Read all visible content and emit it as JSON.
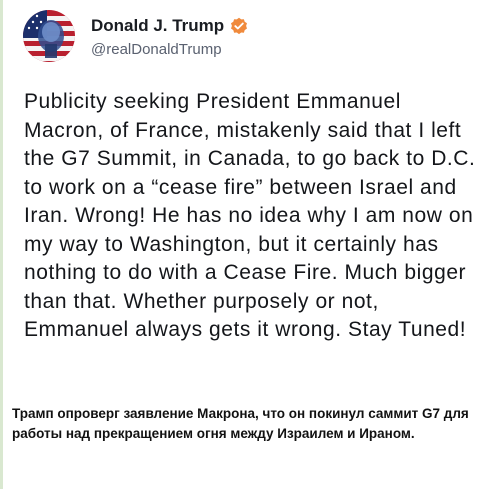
{
  "post": {
    "author_name": "Donald J. Trump",
    "handle": "@realDonaldTrump",
    "verified_icon": "verified-badge-icon",
    "verified_color": "#f08a3c",
    "text": "Publicity seeking President Emmanuel Macron, of France, mistakenly said that I left the G7 Summit, in Canada, to go back to D.C. to work on a “cease fire” between Israel and Iran. Wrong! He has no idea why I am now on my way to Washington, but it certainly has nothing to do with a Cease Fire. Much bigger than that. Whether purposely or not, Emmanuel always gets it wrong. Stay Tuned!"
  },
  "caption": {
    "text": "Трамп опроверг заявление Макрона, что он покинул саммит G7 для работы над прекращением огня между Израилем и Ираном."
  }
}
